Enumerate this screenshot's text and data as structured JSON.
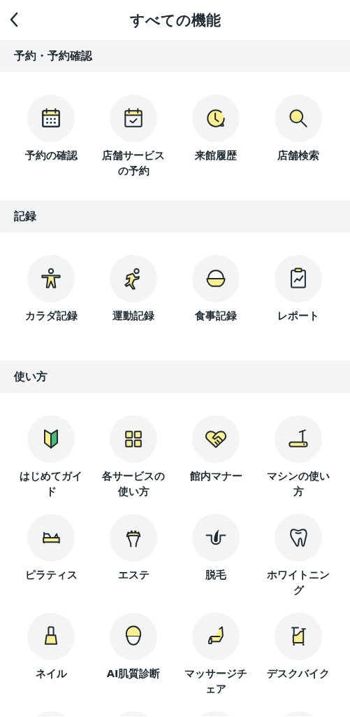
{
  "header": {
    "title": "すべての機能"
  },
  "sections": [
    {
      "title": "予約・予約確認",
      "items": [
        {
          "kind": "item",
          "label": "予約の確認"
        },
        {
          "kind": "item",
          "label": "店舗サービスの予約"
        },
        {
          "kind": "item",
          "label": "来館履歴"
        },
        {
          "kind": "item",
          "label": "店舗検索"
        }
      ]
    },
    {
      "title": "記録",
      "items": [
        {
          "kind": "item",
          "label": "カラダ記録"
        },
        {
          "kind": "item",
          "label": "運動記録"
        },
        {
          "kind": "item",
          "label": "食事記録"
        },
        {
          "kind": "item",
          "label": "レポート"
        }
      ]
    },
    {
      "title": "使い方",
      "items": [
        {
          "kind": "item",
          "label": "はじめてガイド"
        },
        {
          "kind": "item",
          "label": "各サービスの使い方"
        },
        {
          "kind": "item",
          "label": "館内マナー"
        },
        {
          "kind": "item",
          "label": "マシンの使い方"
        },
        {
          "kind": "item",
          "label": "ピラティス"
        },
        {
          "kind": "item",
          "label": "エステ"
        },
        {
          "kind": "item",
          "label": "脱毛"
        },
        {
          "kind": "item",
          "label": "ホワイトニング"
        },
        {
          "kind": "item",
          "label": "ネイル"
        },
        {
          "kind": "item",
          "label": "AI肌質診断"
        },
        {
          "kind": "item",
          "label": "マッサージチェア"
        },
        {
          "kind": "item",
          "label": "デスクバイク"
        },
        {
          "kind": "cut"
        },
        {
          "kind": "cut"
        },
        {
          "kind": "cut"
        },
        {
          "kind": "cut"
        }
      ]
    }
  ]
}
